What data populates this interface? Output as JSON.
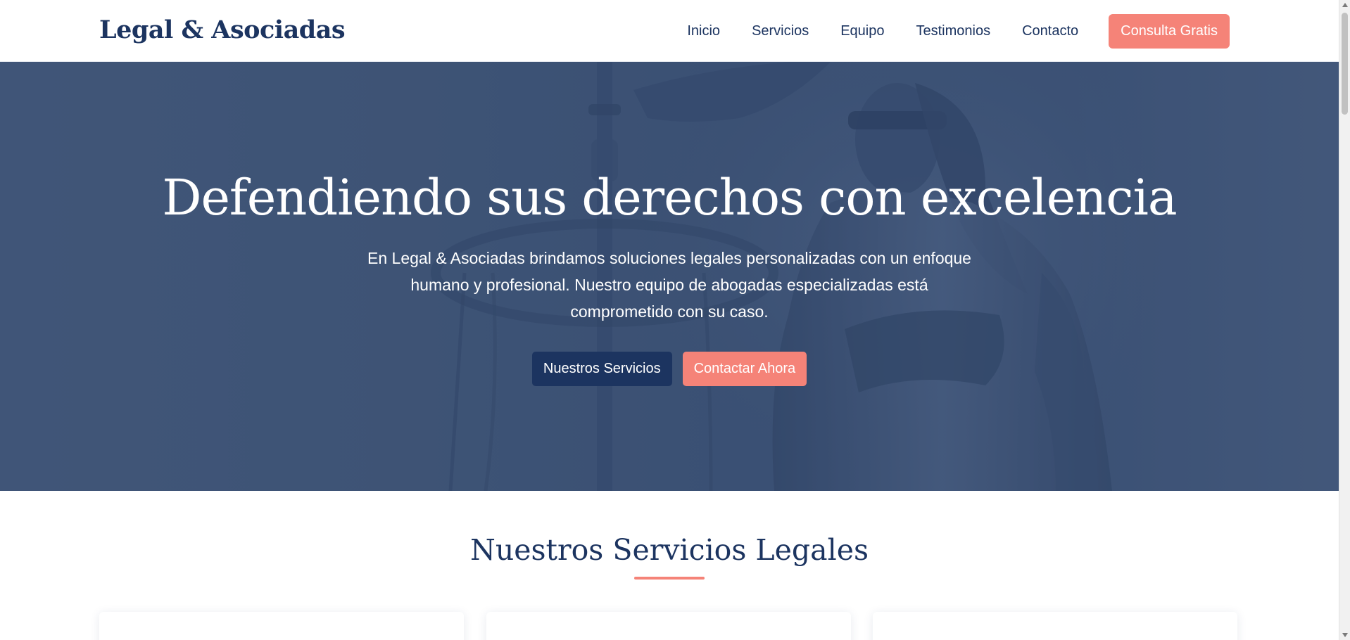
{
  "header": {
    "logo": "Legal & Asociadas",
    "nav": [
      {
        "label": "Inicio"
      },
      {
        "label": "Servicios"
      },
      {
        "label": "Equipo"
      },
      {
        "label": "Testimonios"
      },
      {
        "label": "Contacto"
      }
    ],
    "cta_label": "Consulta Gratis"
  },
  "hero": {
    "title": "Defendiendo sus derechos con excelencia",
    "text": "En Legal & Asociadas brindamos soluciones legales personalizadas con un enfoque humano y profesional. Nuestro equipo de abogadas especializadas está comprometido con su caso.",
    "primary_button": "Nuestros Servicios",
    "secondary_button": "Contactar Ahora",
    "background_image": "lady-justice-statue-image"
  },
  "services": {
    "title": "Nuestros Servicios Legales"
  },
  "colors": {
    "navy": "#1c3460",
    "coral": "#f58378",
    "hero_overlay": "#3d5275",
    "white": "#ffffff"
  }
}
